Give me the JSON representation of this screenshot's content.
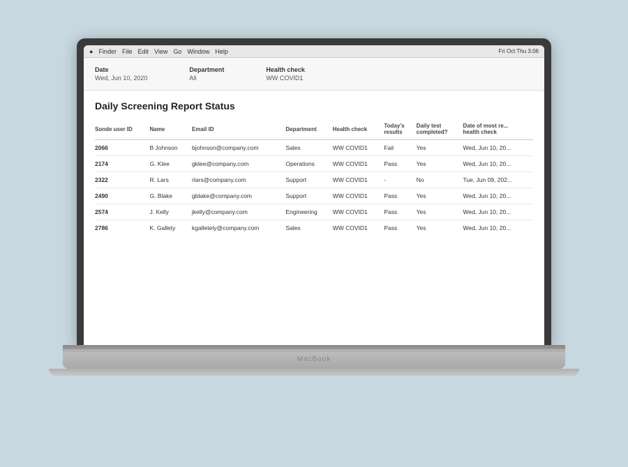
{
  "menubar": {
    "app": "Finder",
    "menus": [
      "File",
      "Edit",
      "View",
      "Go",
      "Window",
      "Help"
    ],
    "right": "Fri Oct Thu 3:06"
  },
  "filters": {
    "date_label": "Date",
    "date_value": "Wed, Jun 10, 2020",
    "department_label": "Department",
    "department_value": "All",
    "healthcheck_label": "Health check",
    "healthcheck_value": "WW COVID1"
  },
  "report": {
    "title": "Daily Screening Report Status",
    "table": {
      "columns": [
        "Sonde user ID",
        "Name",
        "Email ID",
        "Department",
        "Health check",
        "Today's results",
        "Daily test completed?",
        "Date of most recent health check"
      ],
      "rows": [
        {
          "id": "2066",
          "name": "B Johnson",
          "email": "bjohnson@company.com",
          "department": "Sales",
          "healthcheck": "WW COVID1",
          "results": "Fail",
          "completed": "Yes",
          "date": "Wed, Jun 10, 20..."
        },
        {
          "id": "2174",
          "name": "G. Klee",
          "email": "gklee@company.com",
          "department": "Operations",
          "healthcheck": "WW COVID1",
          "results": "Pass",
          "completed": "Yes",
          "date": "Wed, Jun 10, 20..."
        },
        {
          "id": "2322",
          "name": "R. Lars",
          "email": "rlars@company.com",
          "department": "Support",
          "healthcheck": "WW COVID1",
          "results": "-",
          "completed": "No",
          "date": "Tue, Jun 09, 202..."
        },
        {
          "id": "2490",
          "name": "G. Blake",
          "email": "gblake@company.com",
          "department": "Support",
          "healthcheck": "WW COVID1",
          "results": "Pass",
          "completed": "Yes",
          "date": "Wed, Jun 10, 20..."
        },
        {
          "id": "2574",
          "name": "J. Kelly",
          "email": "jkelly@company.com",
          "department": "Engineering",
          "healthcheck": "WW COVID1",
          "results": "Pass",
          "completed": "Yes",
          "date": "Wed, Jun 10, 20..."
        },
        {
          "id": "2786",
          "name": "K. Gallety",
          "email": "kgalletely@company.com",
          "department": "Sales",
          "healthcheck": "WW COVID1",
          "results": "Pass",
          "completed": "Yes",
          "date": "Wed, Jun 10, 20..."
        }
      ]
    }
  },
  "laptop": {
    "brand": "MacBook"
  }
}
